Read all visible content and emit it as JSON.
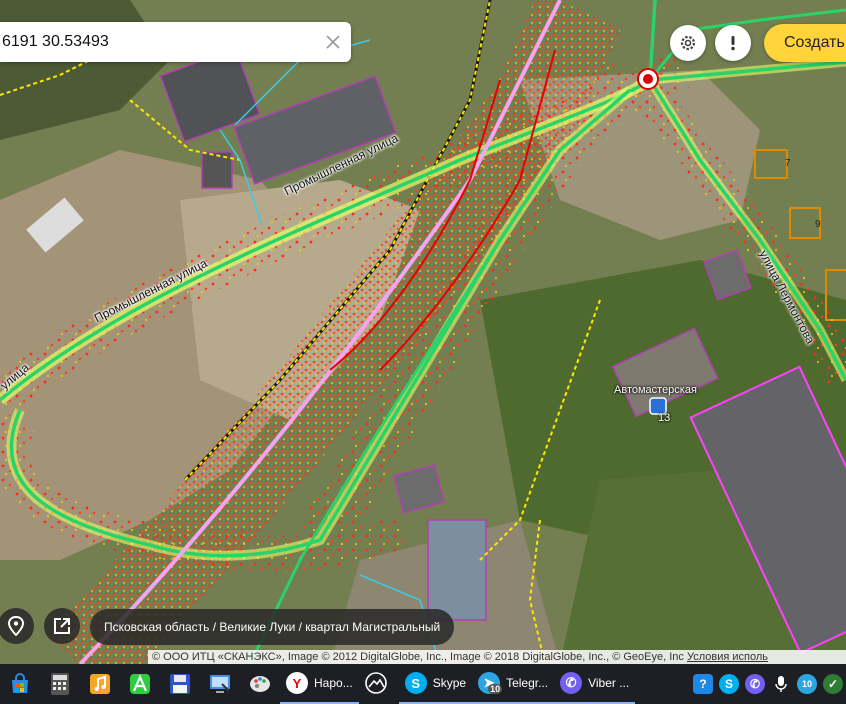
{
  "search": {
    "value": "6191 30.53493",
    "clear_icon": "close-icon"
  },
  "header": {
    "settings_icon": "gear-icon",
    "alert_icon": "exclamation-icon",
    "create_label": "Создать"
  },
  "map": {
    "street_labels": {
      "promyshlennaya_1": "Промышленная улица",
      "promyshlennaya_2": "Промышленная улица",
      "ulitsa_left": "улица",
      "lermontova": "улица Лермонтова"
    },
    "poi": {
      "name": "Автомастерская",
      "number": "13"
    },
    "building_numbers": [
      "7",
      "9"
    ]
  },
  "bottom": {
    "location_icon": "location-pin-icon",
    "share_icon": "share-icon",
    "breadcrumb": "Псковская область / Великие Луки / квартал Магистральный",
    "copyright": "© ООО ИТЦ «СКАНЭКС», Image © 2012 DigitalGlobe, Inc., Image © 2018 DigitalGlobe, Inc., © GeoEye, Inc",
    "terms_link": "Условия исполь"
  },
  "taskbar": {
    "apps": [
      {
        "name": "store-icon",
        "color": "#2a8ce0"
      },
      {
        "name": "calculator-icon",
        "color": "#6c6c6c"
      },
      {
        "name": "music-app-icon",
        "color": "#f5a623"
      },
      {
        "name": "green-a-icon",
        "color": "#2ecc40"
      },
      {
        "name": "floppy-icon",
        "color": "#2b56c4"
      },
      {
        "name": "remote-desktop-icon",
        "color": "#4a90e2"
      },
      {
        "name": "paint-icon",
        "color": "#e6e6e6"
      }
    ],
    "windows": [
      {
        "label": "Наро...",
        "icon": "yandex-browser-icon",
        "color": "#ffffff",
        "glyph": "Y"
      },
      {
        "label": "",
        "icon": "cloud-app-icon",
        "color": "#ffffff",
        "glyph": ""
      },
      {
        "label": "Skype",
        "icon": "skype-icon",
        "color": "#00aff0",
        "glyph": "S"
      },
      {
        "label": "Telegr...",
        "icon": "telegram-icon",
        "color": "#2ca5e0",
        "glyph": "➤",
        "badge": "10"
      },
      {
        "label": "Viber ...",
        "icon": "viber-icon",
        "color": "#7360f2",
        "glyph": "✆"
      }
    ],
    "tray": [
      {
        "name": "help-icon",
        "color": "#1e88e5",
        "glyph": "?"
      },
      {
        "name": "skype-tray-icon",
        "color": "#00aff0",
        "glyph": "S"
      },
      {
        "name": "viber-tray-icon",
        "color": "#7360f2",
        "glyph": "✆"
      },
      {
        "name": "microphone-icon",
        "color": "#888888",
        "glyph": "🎤"
      },
      {
        "name": "telegram-tray-icon",
        "color": "#2ca5e0",
        "glyph": "10"
      },
      {
        "name": "shield-tray-icon",
        "color": "#2e7d32",
        "glyph": "✓"
      }
    ]
  }
}
